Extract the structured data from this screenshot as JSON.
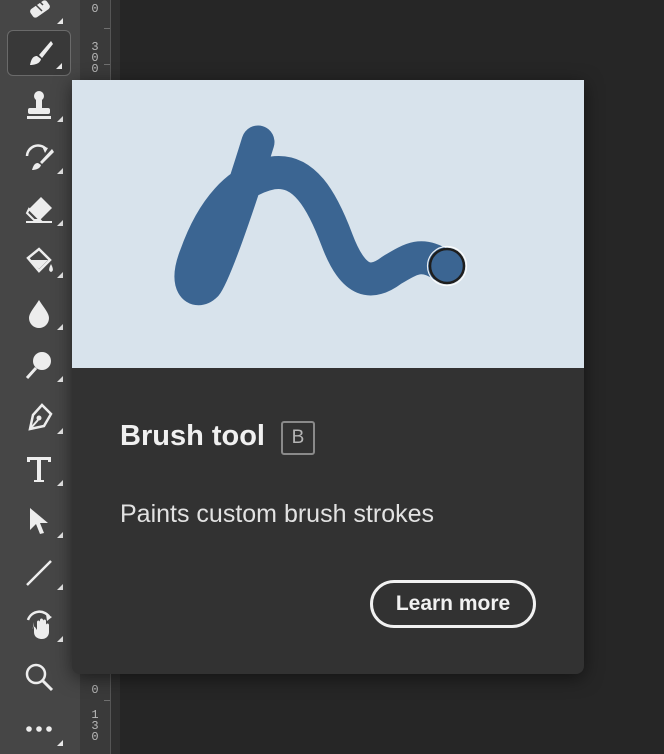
{
  "toolbar": {
    "tools": [
      {
        "name": "healing-brush-icon",
        "active": false
      },
      {
        "name": "brush-icon",
        "active": true
      },
      {
        "name": "clone-stamp-icon",
        "active": false
      },
      {
        "name": "history-brush-icon",
        "active": false
      },
      {
        "name": "eraser-icon",
        "active": false
      },
      {
        "name": "paint-bucket-icon",
        "active": false
      },
      {
        "name": "blur-icon",
        "active": false
      },
      {
        "name": "dodge-icon",
        "active": false
      },
      {
        "name": "pen-icon",
        "active": false
      },
      {
        "name": "type-icon",
        "active": false
      },
      {
        "name": "path-selection-icon",
        "active": false
      },
      {
        "name": "line-icon",
        "active": false
      },
      {
        "name": "rotate-view-icon",
        "active": false
      },
      {
        "name": "zoom-icon",
        "active": false
      },
      {
        "name": "more-tools-icon",
        "active": false
      }
    ]
  },
  "ruler": {
    "labels": [
      {
        "digits": [
          "0"
        ]
      },
      {
        "digits": [
          "3",
          "0",
          "0"
        ]
      },
      {
        "digits": [
          "0"
        ]
      },
      {
        "digits": [
          "1",
          "3",
          "0"
        ]
      }
    ]
  },
  "tooltip": {
    "title": "Brush tool",
    "shortcut": "B",
    "description": "Paints custom brush strokes",
    "learn_more_label": "Learn more",
    "preview_bg_color": "#d8e3ec",
    "stroke_color": "#3b6592"
  }
}
